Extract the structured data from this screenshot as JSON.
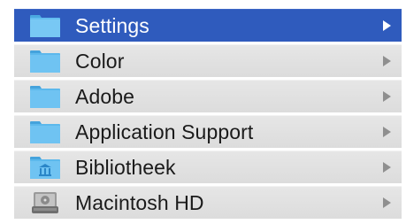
{
  "menu": {
    "items": [
      {
        "label": "Settings",
        "icon": "folder-icon",
        "selected": true
      },
      {
        "label": "Color",
        "icon": "folder-icon",
        "selected": false
      },
      {
        "label": "Adobe",
        "icon": "folder-icon",
        "selected": false
      },
      {
        "label": "Application Support",
        "icon": "folder-icon",
        "selected": false
      },
      {
        "label": "Bibliotheek",
        "icon": "library-folder-icon",
        "selected": false
      },
      {
        "label": "Macintosh HD",
        "icon": "hard-drive-icon",
        "selected": false
      }
    ]
  },
  "colors": {
    "selection": "#2f5bbd",
    "folder": "#5cb8ec",
    "row_background": "#e0e0e0"
  }
}
